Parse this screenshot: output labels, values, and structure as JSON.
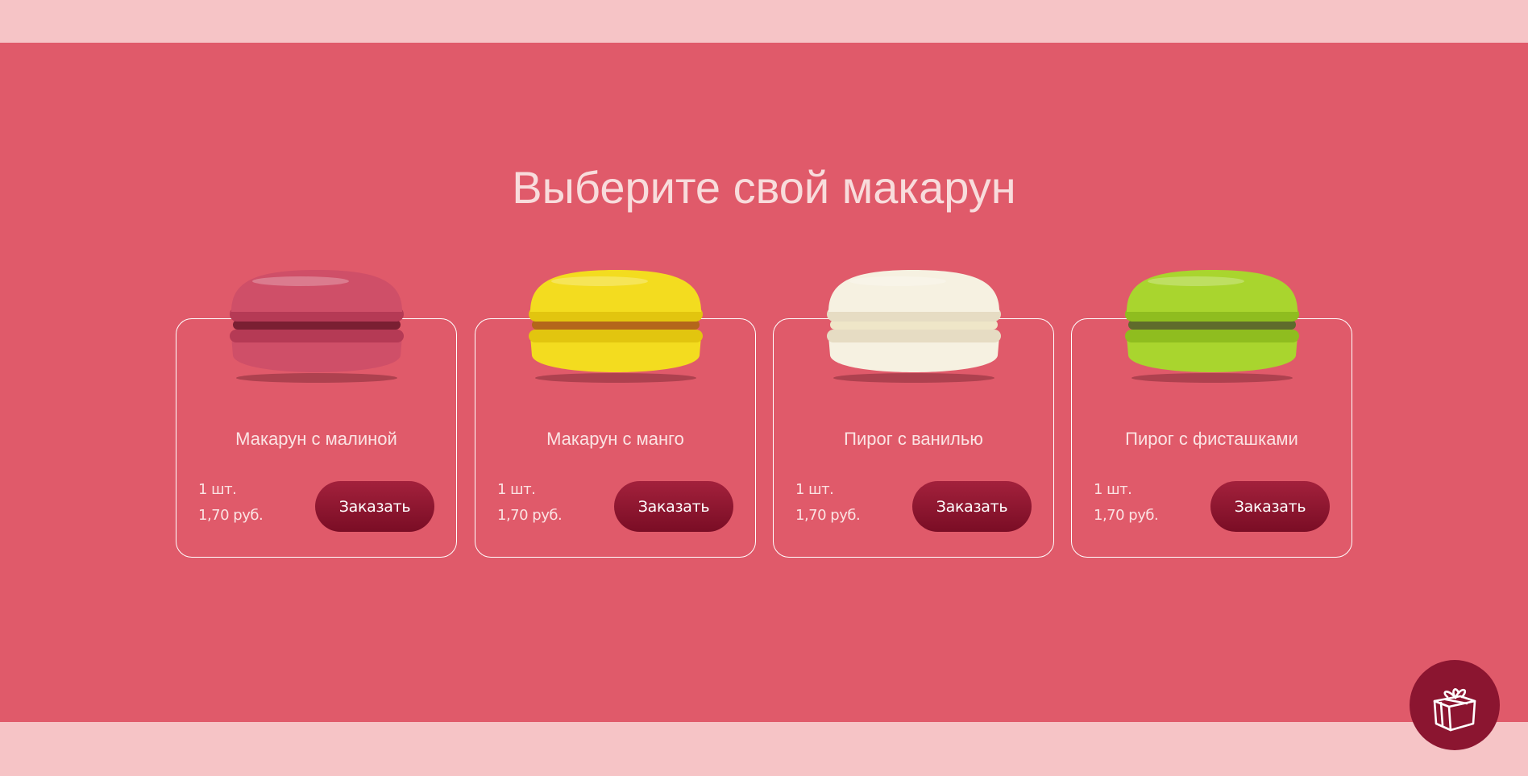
{
  "heading": "Выберите свой макарун",
  "products": [
    {
      "name": "Макарун с малиной",
      "qty": "1 шт.",
      "price": "1,70 руб.",
      "button": "Заказать",
      "colors": {
        "shell": "#cf4f68",
        "shell_dark": "#b53a55",
        "filling": "#7a1f32"
      }
    },
    {
      "name": "Макарун с манго",
      "qty": "1 шт.",
      "price": "1,70 руб.",
      "button": "Заказать",
      "colors": {
        "shell": "#f3dc1f",
        "shell_dark": "#e2c50f",
        "filling": "#b4661b"
      }
    },
    {
      "name": "Пирог с ванилью",
      "qty": "1 шт.",
      "price": "1,70 руб.",
      "button": "Заказать",
      "colors": {
        "shell": "#f6f1e1",
        "shell_dark": "#e6dcc3",
        "filling": "#efe6c8"
      }
    },
    {
      "name": "Пирог с фисташками",
      "qty": "1 шт.",
      "price": "1,70 руб.",
      "button": "Заказать",
      "colors": {
        "shell": "#a9d52e",
        "shell_dark": "#8fbd1f",
        "filling": "#5f6b2c"
      }
    }
  ],
  "gift_button": {
    "icon": "gift-icon"
  },
  "theme": {
    "section_bg": "#e05a6a",
    "strip_bg": "#f6c4c6",
    "button_bg": "#8b1530"
  }
}
